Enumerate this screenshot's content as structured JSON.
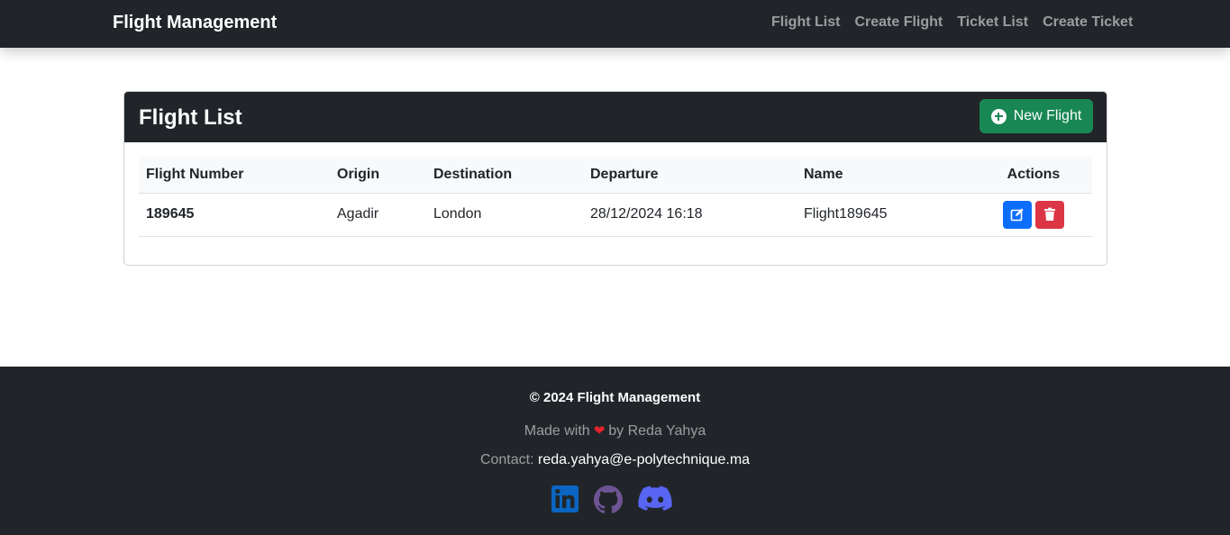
{
  "navbar": {
    "brand": "Flight Management",
    "links": [
      "Flight List",
      "Create Flight",
      "Ticket List",
      "Create Ticket"
    ]
  },
  "card": {
    "title": "Flight List",
    "new_button": "New Flight",
    "columns": [
      "Flight Number",
      "Origin",
      "Destination",
      "Departure",
      "Name",
      "Actions"
    ],
    "rows": [
      {
        "flight_number": "189645",
        "origin": "Agadir",
        "destination": "London",
        "departure": "28/12/2024 16:18",
        "name": "Flight189645"
      }
    ]
  },
  "footer": {
    "copyright": "© 2024 Flight Management",
    "made_prefix": "Made with",
    "made_suffix": "by Reda Yahya",
    "contact_label": "Contact:",
    "email": "reda.yahya@e-polytechnique.ma",
    "socials": [
      "linkedin-icon",
      "github-icon",
      "discord-icon"
    ]
  },
  "colors": {
    "dark": "#212529",
    "success": "#198754",
    "primary": "#0d6efd",
    "danger": "#dc3545",
    "linkedin": "#0a66c2",
    "github": "#6e5494",
    "discord": "#5865f2"
  }
}
